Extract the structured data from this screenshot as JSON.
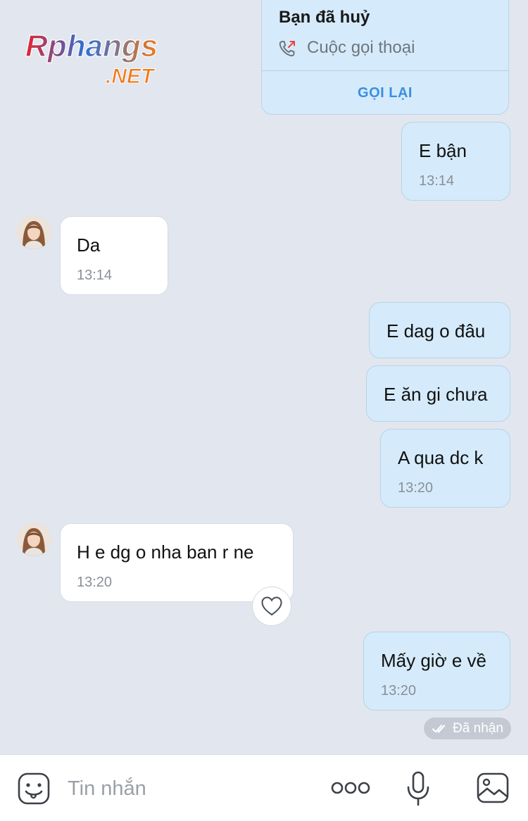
{
  "watermark": {
    "brand": "Rphangs",
    "suffix": ".NET"
  },
  "call_card": {
    "title": "Bạn đã huỷ",
    "subtitle": "Cuộc gọi thoại",
    "action": "GỌI LẠI",
    "icon": "outgoing-call-icon"
  },
  "messages": [
    {
      "direction": "out",
      "text": "E bận",
      "time": "13:14"
    },
    {
      "direction": "in",
      "text": "Da",
      "time": "13:14"
    },
    {
      "direction": "out",
      "text": "E dag o đâu",
      "time": ""
    },
    {
      "direction": "out",
      "text": "E ăn gi chưa",
      "time": ""
    },
    {
      "direction": "out",
      "text": "A qua dc k",
      "time": "13:20"
    },
    {
      "direction": "in",
      "text": "H e dg o nha ban r ne",
      "time": "13:20",
      "reaction_icon": "heart-icon"
    },
    {
      "direction": "out",
      "text": "Mấy giờ e về",
      "time": "13:20"
    }
  ],
  "status": {
    "label": "Đã nhận",
    "icon": "double-check-icon"
  },
  "composer": {
    "placeholder": "Tin nhắn",
    "icons": [
      "sticker-icon",
      "more-icon",
      "microphone-icon",
      "image-icon"
    ]
  },
  "colors": {
    "background": "#e2e6ef",
    "outgoing_bubble": "#d5ebfb",
    "incoming_bubble": "#ffffff",
    "accent": "#3a8fe0"
  }
}
